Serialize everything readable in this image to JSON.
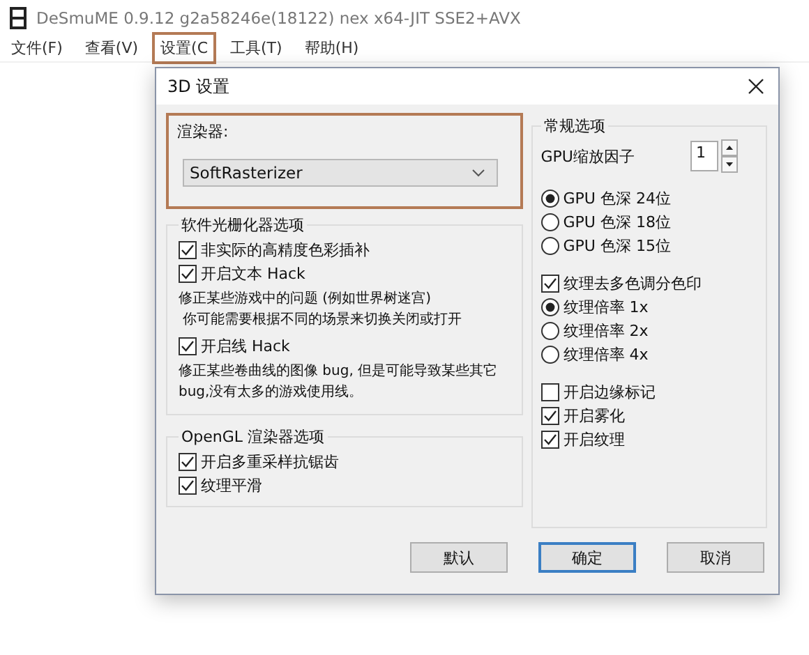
{
  "window": {
    "title": "DeSmuME 0.9.12 g2a58246e(18122) nex x64-JIT SSE2+AVX"
  },
  "menu": [
    {
      "label": "文件(F)",
      "highlighted": false
    },
    {
      "label": "查看(V)",
      "highlighted": false
    },
    {
      "label": "设置(C",
      "highlighted": true
    },
    {
      "label": "工具(T)",
      "highlighted": false
    },
    {
      "label": "帮助(H)",
      "highlighted": false
    }
  ],
  "dialog": {
    "title": "3D 设置",
    "renderer": {
      "label": "渲染器:",
      "value": "SoftRasterizer",
      "highlighted": true
    },
    "software_group": {
      "title": "软件光栅化器选项",
      "items": [
        {
          "kind": "checkbox",
          "label": "非实际的高精度色彩插补",
          "checked": true
        },
        {
          "kind": "checkbox",
          "label": "开启文本 Hack",
          "checked": true
        },
        {
          "kind": "note",
          "lines": [
            "修正某些游戏中的问题 (例如世界树迷宫)",
            " 你可能需要根据不同的场景来切换关闭或打开"
          ]
        },
        {
          "kind": "checkbox",
          "label": "开启线 Hack",
          "checked": true
        },
        {
          "kind": "note",
          "lines": [
            "修正某些卷曲线的图像 bug, 但是可能导致某些其它",
            "bug,没有太多的游戏使用线。"
          ]
        }
      ]
    },
    "opengl_group": {
      "title": "OpenGL 渲染器选项",
      "items": [
        {
          "kind": "checkbox",
          "label": "开启多重采样抗锯齿",
          "checked": true
        },
        {
          "kind": "checkbox",
          "label": "纹理平滑",
          "checked": true
        }
      ]
    },
    "general_group": {
      "title": "常规选项",
      "sections": [
        [
          {
            "kind": "spinner",
            "label": "GPU缩放因子",
            "value": "1"
          }
        ],
        [
          {
            "kind": "radio",
            "label": "GPU 色深 24位",
            "selected": true
          },
          {
            "kind": "radio",
            "label": "GPU 色深 18位",
            "selected": false
          },
          {
            "kind": "radio",
            "label": "GPU 色深 15位",
            "selected": false
          }
        ],
        [
          {
            "kind": "checkbox",
            "label": "纹理去多色调分色印",
            "checked": true
          },
          {
            "kind": "radio",
            "label": "纹理倍率 1x",
            "selected": true
          },
          {
            "kind": "radio",
            "label": "纹理倍率 2x",
            "selected": false
          },
          {
            "kind": "radio",
            "label": "纹理倍率 4x",
            "selected": false
          }
        ],
        [
          {
            "kind": "checkbox",
            "label": "开启边缘标记",
            "checked": false
          },
          {
            "kind": "checkbox",
            "label": "开启雾化",
            "checked": true
          },
          {
            "kind": "checkbox",
            "label": "开启纹理",
            "checked": true
          }
        ]
      ]
    },
    "buttons": [
      {
        "label": "默认",
        "default": false
      },
      {
        "label": "确定",
        "default": true
      },
      {
        "label": "取消",
        "default": false
      }
    ]
  }
}
